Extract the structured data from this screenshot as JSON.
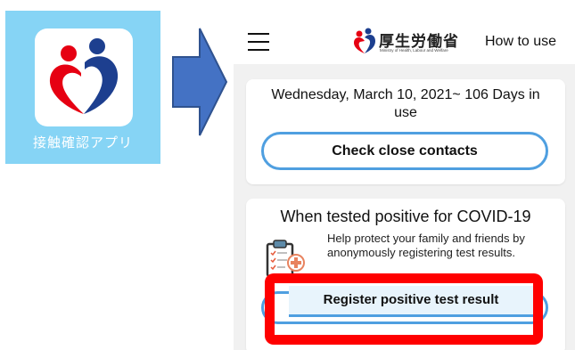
{
  "app_tile": {
    "label": "接触確認アプリ",
    "background": "#86d4f5",
    "icon": "heart-people-logo"
  },
  "arrow": {
    "color": "#4472c4",
    "direction": "right"
  },
  "phone": {
    "menu_icon": "hamburger-icon",
    "brand": {
      "name": "厚生労働省",
      "subtitle": "Ministry of Health, Labour and Welfare"
    },
    "how_to_use": "How to use",
    "usage_card": {
      "date_text": "Wednesday, March 10, 2021~ 106 Days in use",
      "check_button": "Check close contacts"
    },
    "positive_card": {
      "title": "When tested positive for COVID-19",
      "description": "Help protect your family and friends by anonymously registering test results.",
      "register_button": "Register positive test result",
      "icon": "clipboard-plus-icon"
    }
  },
  "colors": {
    "accent_blue": "#4f9fe0",
    "highlight_red": "#ff0000",
    "logo_red": "#e60012",
    "logo_blue": "#1d3f8f"
  }
}
